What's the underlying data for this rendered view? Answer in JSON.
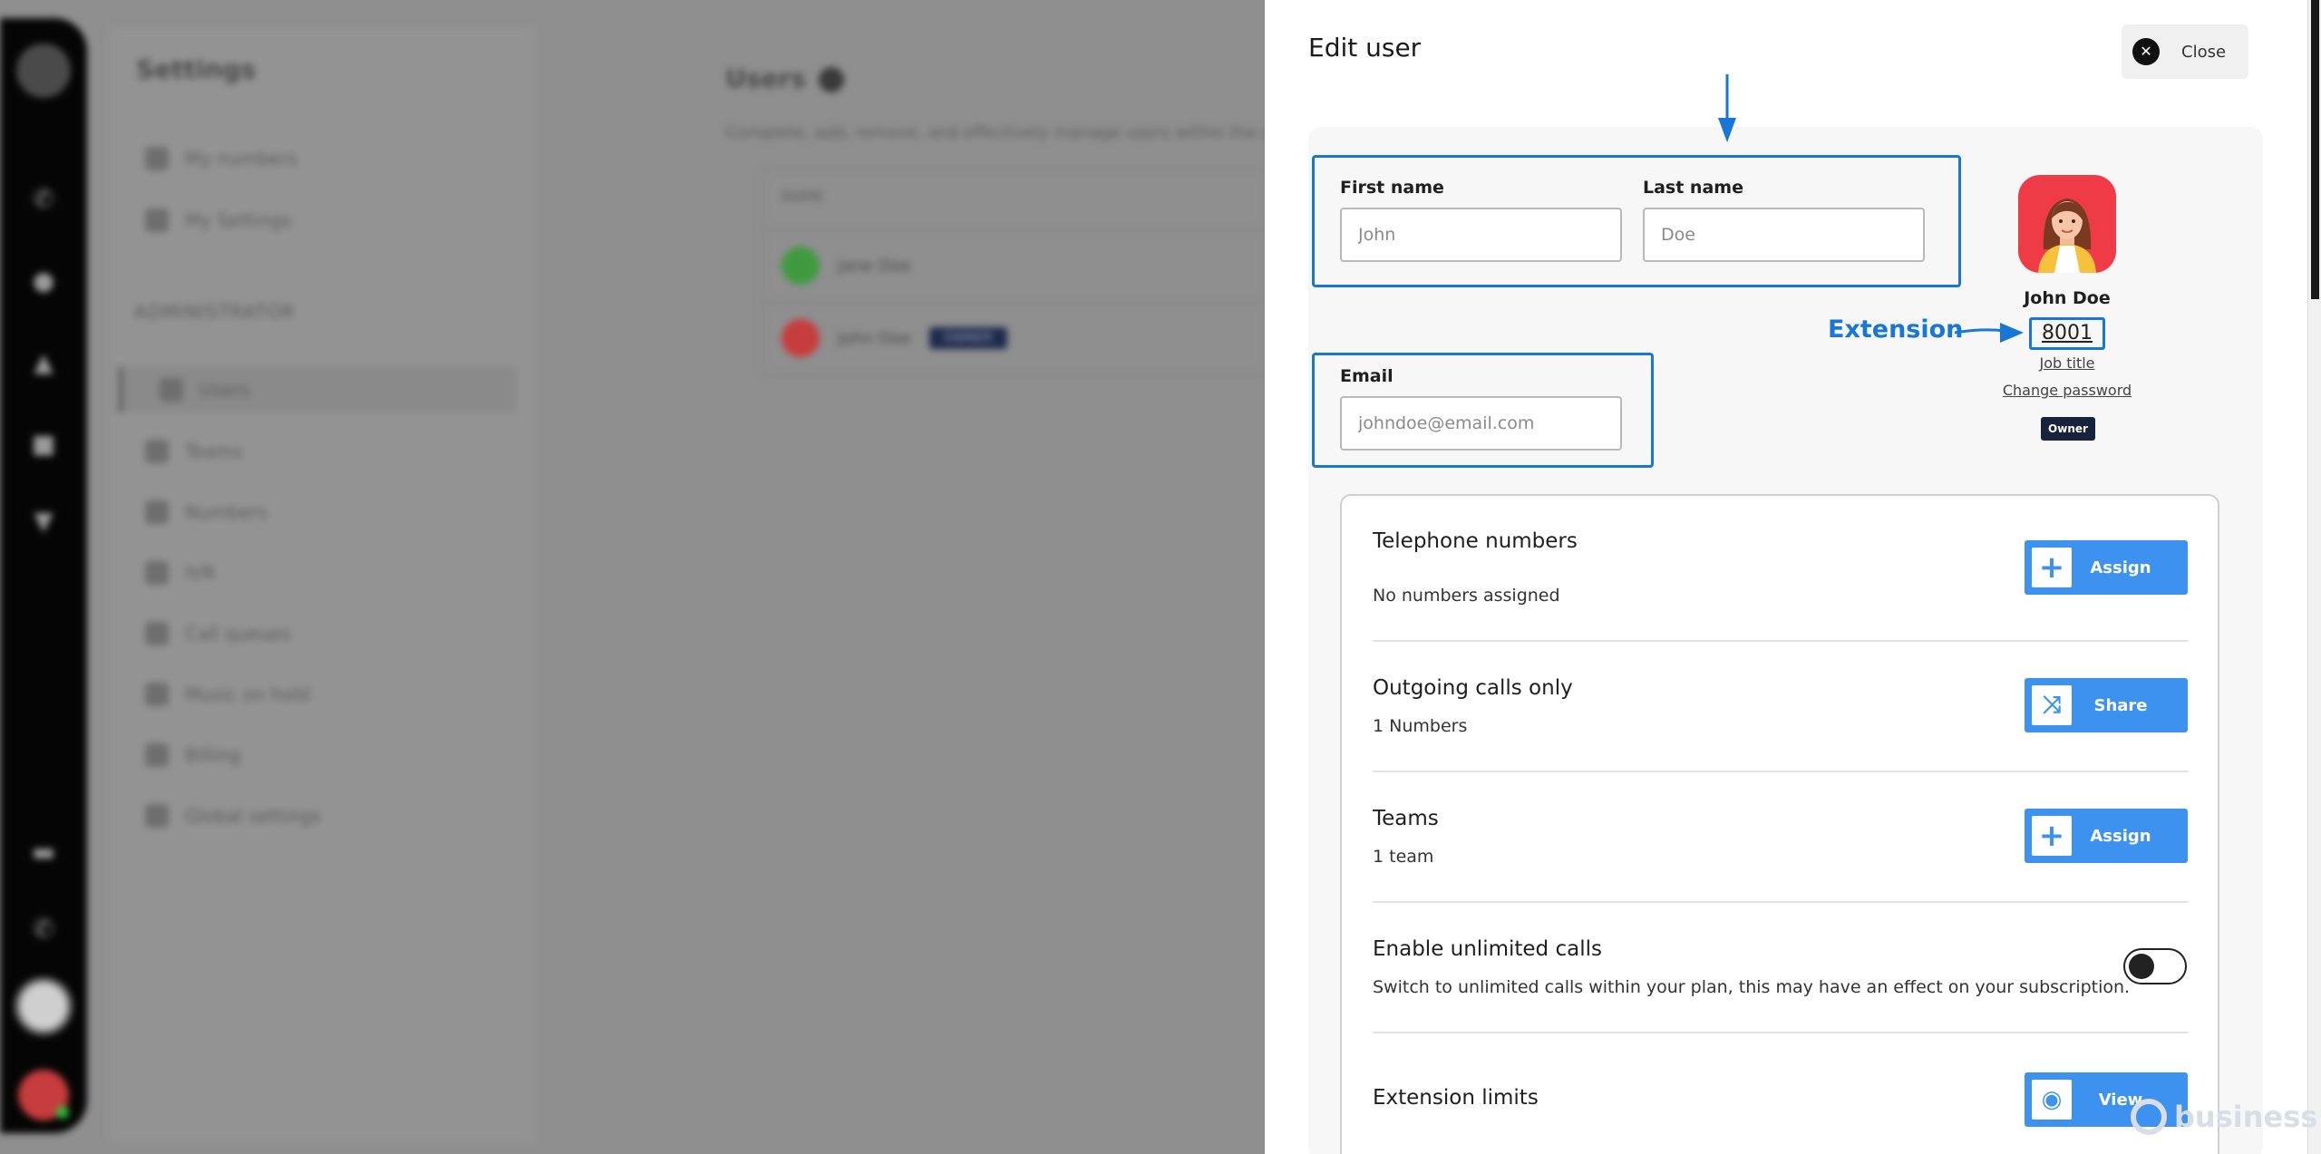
{
  "background": {
    "settings_title": "Settings",
    "my_items": [
      "My numbers",
      "My Settings"
    ],
    "admin_section": "ADMINISTRATOR",
    "admin_items": [
      "Users",
      "Teams",
      "Numbers",
      "IVR",
      "Call queues",
      "Music on hold",
      "Billing",
      "Global settings"
    ],
    "users_title": "Users",
    "users_subtitle": "Complete, add, remove, and effectively manage users within the organization",
    "table_header": "NAME",
    "rows": [
      {
        "name": "Jane Doe",
        "tag": ""
      },
      {
        "name": "John Doe",
        "tag": "OWNER"
      }
    ]
  },
  "drawer": {
    "title": "Edit user",
    "close_label": "Close",
    "first_name": {
      "label": "First name",
      "placeholder": "John"
    },
    "last_name": {
      "label": "Last name",
      "placeholder": "Doe"
    },
    "email": {
      "label": "Email",
      "placeholder": "johndoe@email.com"
    },
    "profile": {
      "name": "John Doe",
      "extension": "8001",
      "job_title_link": "Job title",
      "change_password_link": "Change password",
      "role_badge": "Owner"
    },
    "annotation": {
      "extension_label": "Extension"
    },
    "sections": [
      {
        "title": "Telephone numbers",
        "subtitle": "No numbers assigned",
        "button": "Assign",
        "icon": "plus-icon"
      },
      {
        "title": "Outgoing calls only",
        "subtitle": "1 Numbers",
        "button": "Share",
        "icon": "shuffle-icon"
      },
      {
        "title": "Teams",
        "subtitle": "1 team",
        "button": "Assign",
        "icon": "plus-icon"
      },
      {
        "title": "Enable unlimited calls",
        "subtitle": "Switch to unlimited calls within your plan, this may have an effect on your subscription.",
        "toggle_on": false
      },
      {
        "title": "Extension limits",
        "button": "View",
        "icon": "eye-icon"
      }
    ]
  },
  "watermark": "business",
  "colors": {
    "accent": "#3d92f0",
    "annotation": "#1877d6",
    "avatar_bg": "#ee3b45",
    "badge": "#17223d"
  }
}
